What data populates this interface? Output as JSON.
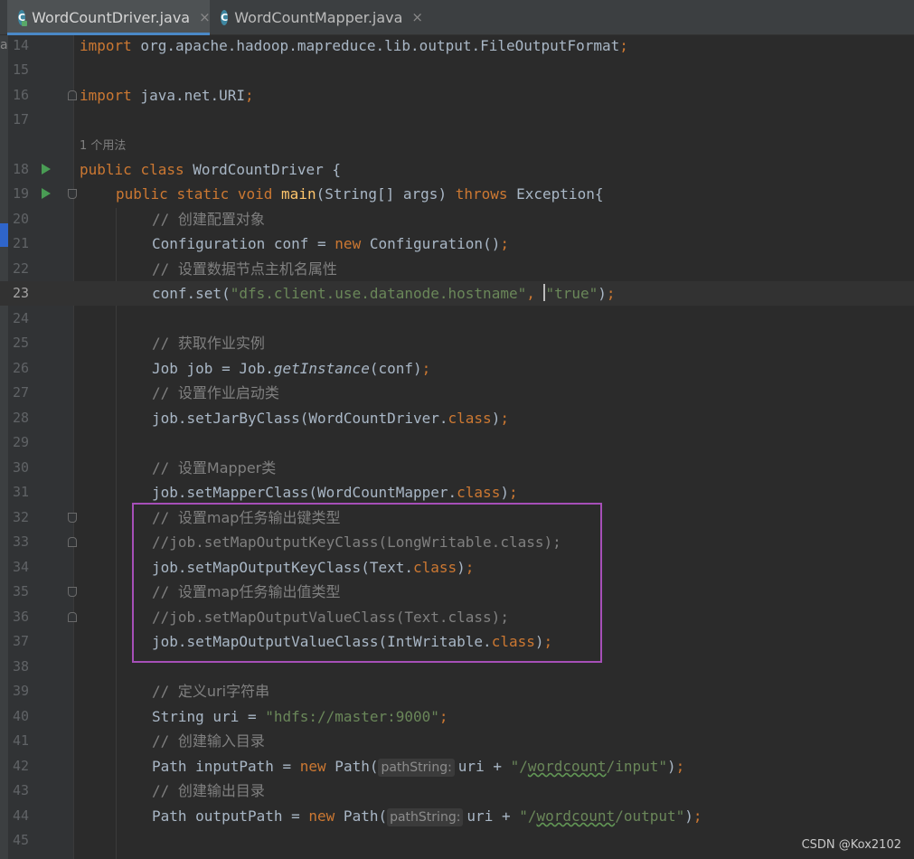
{
  "tabs": [
    {
      "label": "WordCountDriver.java",
      "icon": "java-class-run-icon",
      "close": "×"
    },
    {
      "label": "WordCountMapper.java",
      "icon": "java-class-icon",
      "close": "×"
    }
  ],
  "left_strip_letter": "a",
  "usage_hint": "1 个用法",
  "lines": {
    "n14": "14",
    "n15": "15",
    "n16": "16",
    "n17": "17",
    "n18": "18",
    "n19": "19",
    "n20": "20",
    "n21": "21",
    "n22": "22",
    "n23": "23",
    "n24": "24",
    "n25": "25",
    "n26": "26",
    "n27": "27",
    "n28": "28",
    "n29": "29",
    "n30": "30",
    "n31": "31",
    "n32": "32",
    "n33": "33",
    "n34": "34",
    "n35": "35",
    "n36": "36",
    "n37": "37",
    "n38": "38",
    "n39": "39",
    "n40": "40",
    "n41": "41",
    "n42": "42",
    "n43": "43",
    "n44": "44",
    "n45": "45"
  },
  "code": {
    "l14": {
      "kw": "import",
      "rest": " org.apache.hadoop.mapreduce.lib.output.FileOutputFormat",
      "semi": ";"
    },
    "l16": {
      "kw": "import",
      "rest": " java.net.URI",
      "semi": ";"
    },
    "l18": {
      "kw1": "public",
      "kw2": "class",
      "rest": " WordCountDriver {"
    },
    "l19": {
      "kw1": "public",
      "kw2": "static",
      "kw3": "void",
      "fn": "main",
      "args": "(String[] args) ",
      "kw4": "throws",
      "rest": " Exception{"
    },
    "l20": {
      "slashes": "// ",
      "text": "创建配置对象"
    },
    "l21": {
      "pre": "Configuration conf = ",
      "kw": "new",
      "post": " Configuration()",
      "semi": ";"
    },
    "l22": {
      "slashes": "// ",
      "text": "设置数据节点主机名属性"
    },
    "l23": {
      "pre": "conf.set(",
      "s1": "\"dfs.client.use.datanode.hostname\"",
      "comma": ", ",
      "s2": "\"true\"",
      "post": ")",
      "semi": ";"
    },
    "l25": {
      "slashes": "// ",
      "text": "获取作业实例"
    },
    "l26": {
      "pre": "Job job = Job.",
      "it": "getInstance",
      "post": "(conf)",
      "semi": ";"
    },
    "l27": {
      "slashes": "// ",
      "text": "设置作业启动类"
    },
    "l28": {
      "pre": "job.setJarByClass(WordCountDriver.",
      "kw": "class",
      "post": ")",
      "semi": ";"
    },
    "l30": {
      "slashes": "// ",
      "text": "设置Mapper类"
    },
    "l31": {
      "pre": "job.setMapperClass(WordCountMapper.",
      "kw": "class",
      "post": ")",
      "semi": ";"
    },
    "l32": {
      "slashes": "// ",
      "text": "设置map任务输出键类型"
    },
    "l33": {
      "text": "//job.setMapOutputKeyClass(LongWritable.class);"
    },
    "l34": {
      "pre": "job.setMapOutputKeyClass(Text.",
      "kw": "class",
      "post": ")",
      "semi": ";"
    },
    "l35": {
      "slashes": "// ",
      "text": "设置map任务输出值类型"
    },
    "l36": {
      "text": "//job.setMapOutputValueClass(Text.class);"
    },
    "l37": {
      "pre": "job.setMapOutputValueClass(IntWritable.",
      "kw": "class",
      "post": ")",
      "semi": ";"
    },
    "l39": {
      "slashes": "// ",
      "text": "定义uri字符串"
    },
    "l40": {
      "pre": "String uri = ",
      "str": "\"hdfs://master:9000\"",
      "semi": ";"
    },
    "l41": {
      "slashes": "// ",
      "text": "创建输入目录"
    },
    "l42": {
      "pre": "Path inputPath = ",
      "kw": "new",
      "post": " Path(",
      "hint": "pathString:",
      "mid": "uri + ",
      "q1": "\"/",
      "sq": "wordcount",
      "q2": "/input\"",
      "end": ")",
      "semi": ";"
    },
    "l43": {
      "slashes": "// ",
      "text": "创建输出目录"
    },
    "l44": {
      "pre": "Path outputPath = ",
      "kw": "new",
      "post": " Path(",
      "hint": "pathString:",
      "mid": "uri + ",
      "q1": "\"/",
      "sq": "wordcount",
      "q2": "/output\"",
      "end": ")",
      "semi": ";"
    }
  },
  "watermark": "CSDN @Kox2102",
  "colors": {
    "keyword": "#cc7832",
    "string": "#6a8759",
    "comment": "#808080",
    "method": "#ffc66d",
    "highlight_box": "#a64fb8",
    "background": "#2b2b2b"
  }
}
